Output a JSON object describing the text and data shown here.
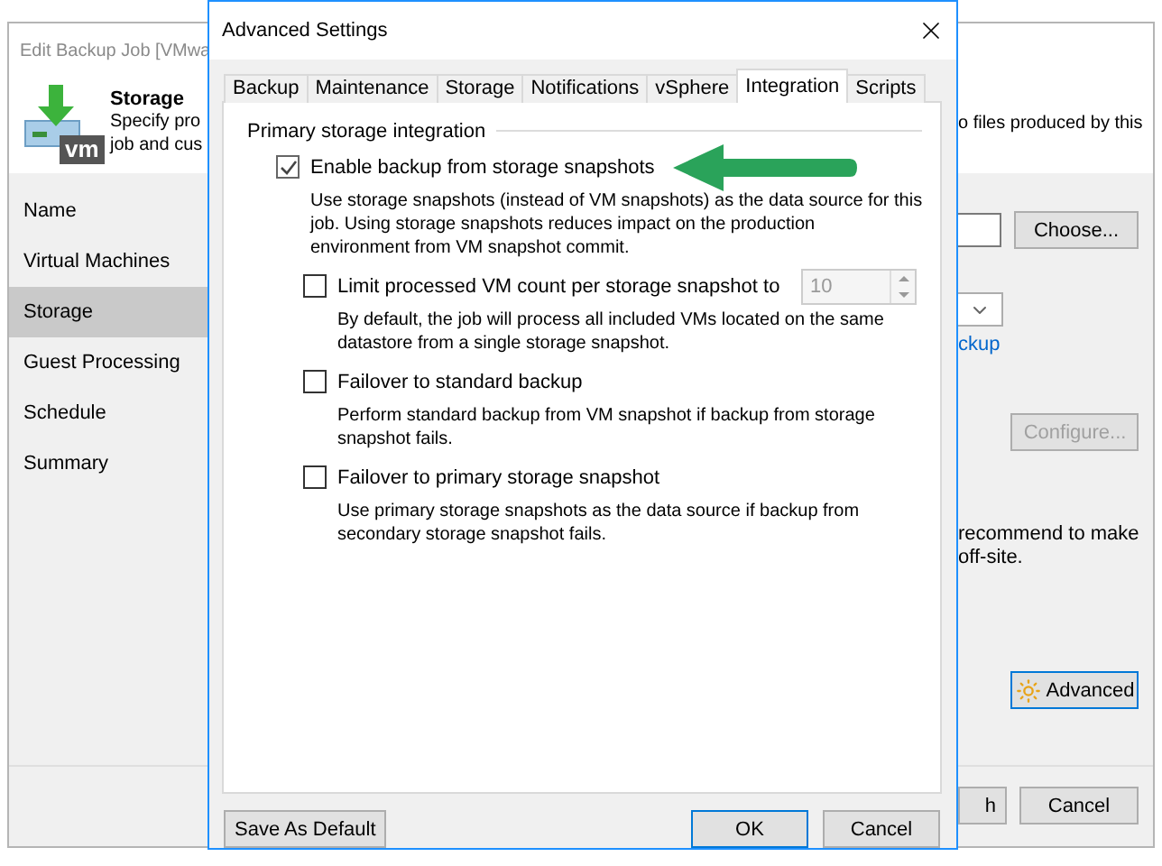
{
  "background_window": {
    "title": "Edit Backup Job [VMwa",
    "header": {
      "title": "Storage",
      "icon_text": "vm",
      "subtitle_lines": [
        "Specify pro",
        "job and cus"
      ],
      "right_text": "o files produced by this"
    },
    "steps": [
      {
        "label": "Name",
        "selected": false
      },
      {
        "label": "Virtual Machines",
        "selected": false
      },
      {
        "label": "Storage",
        "selected": true
      },
      {
        "label": "Guest Processing",
        "selected": false
      },
      {
        "label": "Schedule",
        "selected": false
      },
      {
        "label": "Summary",
        "selected": false
      }
    ],
    "right_panel": {
      "choose_button": "Choose...",
      "link": "ckup",
      "configure_button": {
        "label": "Configure...",
        "disabled": true
      },
      "note_lines": [
        "recommend to make",
        "off-site."
      ],
      "advanced_button": "Advanced"
    },
    "buttons": [
      "h",
      "Cancel"
    ]
  },
  "dialog": {
    "title": "Advanced Settings",
    "tabs": [
      {
        "label": "Backup",
        "selected": false
      },
      {
        "label": "Maintenance",
        "selected": false
      },
      {
        "label": "Storage",
        "selected": false
      },
      {
        "label": "Notifications",
        "selected": false
      },
      {
        "label": "vSphere",
        "selected": false
      },
      {
        "label": "Integration",
        "selected": true
      },
      {
        "label": "Scripts",
        "selected": false
      }
    ],
    "group_title": "Primary storage integration",
    "options": [
      {
        "label": "Enable backup from storage snapshots",
        "checked": true,
        "description": [
          "Use storage snapshots (instead of VM snapshots) as the data source for this",
          "job. Using storage snapshots reduces impact on the production",
          "environment from VM snapshot commit."
        ],
        "children": [
          {
            "label": "Limit processed VM count per storage snapshot to",
            "checked": false,
            "spin": {
              "value": "10",
              "disabled": true
            },
            "description": [
              "By default, the job will process all included VMs located on the same",
              "datastore from a single storage snapshot."
            ]
          },
          {
            "label": "Failover to standard backup",
            "checked": false,
            "description": [
              "Perform standard backup from VM snapshot if backup from storage",
              "snapshot fails."
            ]
          },
          {
            "label": "Failover to primary storage snapshot",
            "checked": false,
            "description": [
              "Use primary storage snapshots as the data source if backup from",
              "secondary storage snapshot fails."
            ]
          }
        ]
      }
    ],
    "buttons": {
      "save_default": "Save As Default",
      "ok": "OK",
      "cancel": "Cancel"
    }
  }
}
